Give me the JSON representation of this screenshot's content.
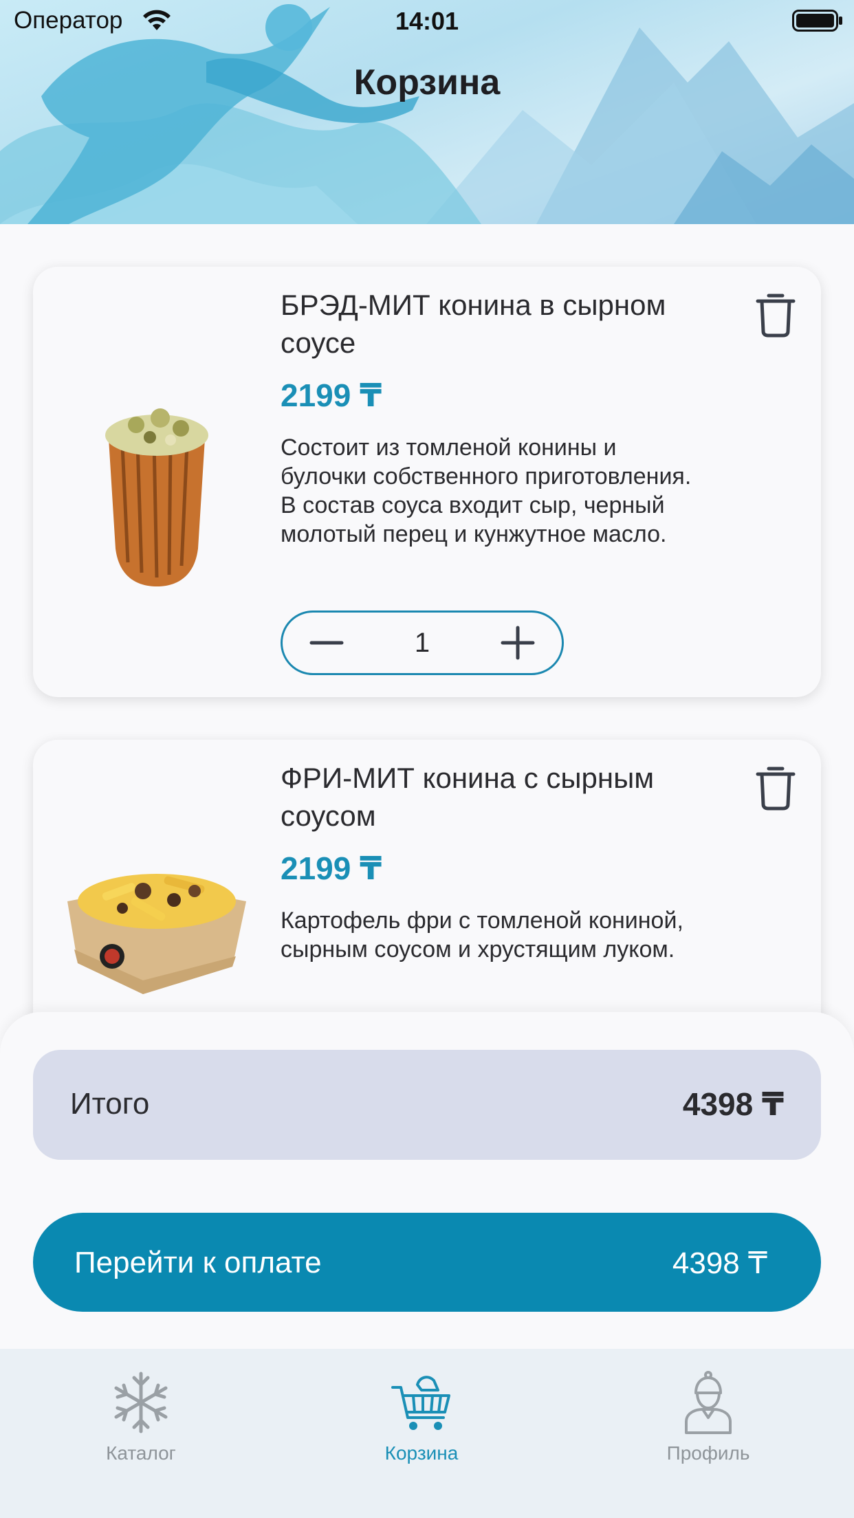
{
  "status_bar": {
    "carrier": "Оператор",
    "time": "14:01"
  },
  "header": {
    "title": "Корзина"
  },
  "cart": {
    "items": [
      {
        "title": "БРЭД-МИТ конина в сырном соусе",
        "price": "2199 ₸",
        "description": "Состоит из томленой конины и булочки собственного приготовления. В состав соуса входит сыр, черный молотый перец и кунжутное масло.",
        "quantity": "1"
      },
      {
        "title": "ФРИ-МИТ конина с сырным соусом",
        "price": "2199 ₸",
        "description": "Картофель фри с томленой кониной, сырным соусом и хрустящим луком."
      }
    ]
  },
  "summary": {
    "total_label": "Итого",
    "total_value": "4398 ₸",
    "pay_label": "Перейти к оплате",
    "pay_amount": "4398 ₸"
  },
  "tabs": [
    {
      "label": "Каталог",
      "icon": "snowflake-icon"
    },
    {
      "label": "Корзина",
      "icon": "cart-icon"
    },
    {
      "label": "Профиль",
      "icon": "profile-icon"
    }
  ],
  "colors": {
    "accent": "#0a89b1",
    "price": "#1a8fb6",
    "total_bg": "#d8dceb",
    "tab_inactive": "#8e9499"
  }
}
